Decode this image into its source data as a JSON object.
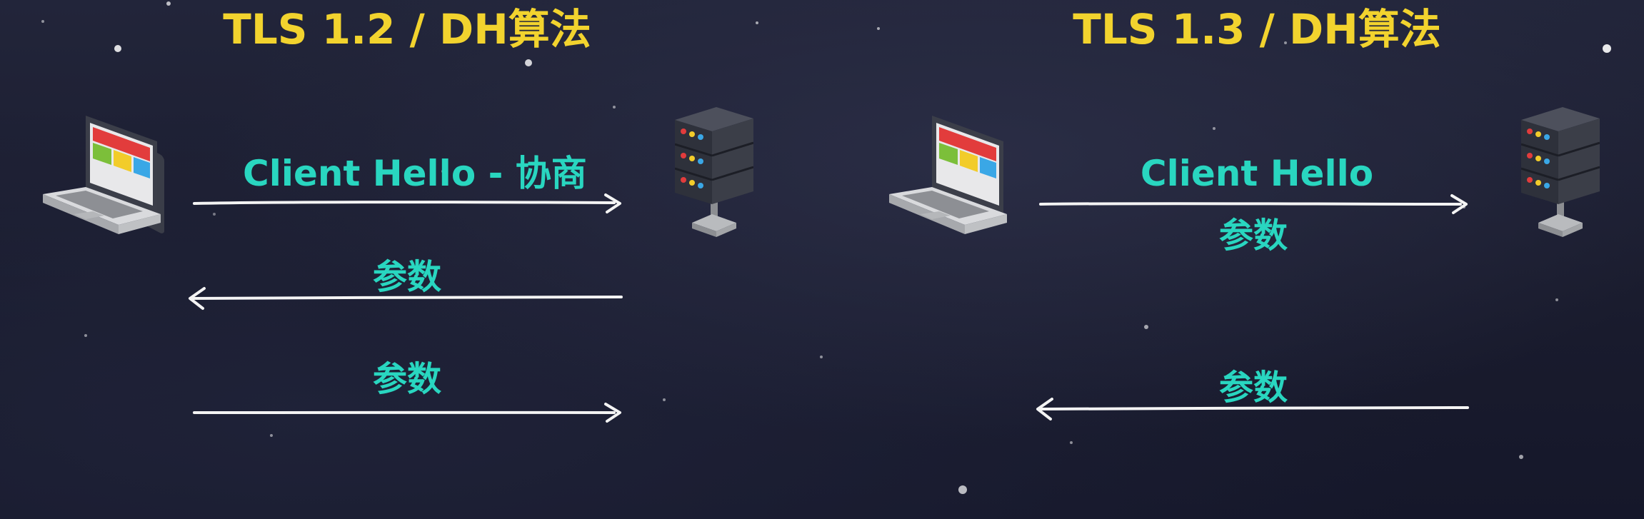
{
  "titles": {
    "left": "TLS 1.2 / DH算法",
    "right": "TLS 1.3 / DH算法"
  },
  "left_panel": {
    "messages": [
      {
        "label": "Client Hello - 协商",
        "direction": "client-to-server"
      },
      {
        "label": "参数",
        "direction": "server-to-client"
      },
      {
        "label": "参数",
        "direction": "client-to-server"
      }
    ]
  },
  "right_panel": {
    "messages": [
      {
        "label": "Client Hello",
        "sublabel": "参数",
        "direction": "client-to-server"
      },
      {
        "label": "参数",
        "direction": "server-to-client"
      }
    ]
  },
  "icons": [
    "laptop-icon",
    "server-icon"
  ],
  "colors": {
    "title": "#f2d32e",
    "label": "#29d6c0",
    "arrow": "#f4f4f4",
    "background": "#1c1e31"
  }
}
